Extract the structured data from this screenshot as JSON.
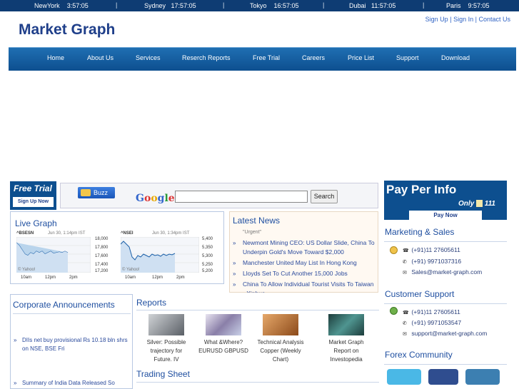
{
  "clocks": [
    {
      "city": "NewYork",
      "time": "3:57:05"
    },
    {
      "city": "Sydney",
      "time": "17:57:05"
    },
    {
      "city": "Tokyo",
      "time": "16:57:05"
    },
    {
      "city": "Dubai",
      "time": "11:57:05"
    },
    {
      "city": "Paris",
      "time": "9:57:05"
    }
  ],
  "header": {
    "logo": "Market Graph",
    "links": {
      "signup": "Sign Up",
      "signin": "Sign In",
      "contact": "Contact Us",
      "sep": "|"
    }
  },
  "nav": [
    "Home",
    "About Us",
    "Services",
    "Reserch Reports",
    "Free Trial",
    "Careers",
    "Price List",
    "Support",
    "Download"
  ],
  "free_trial": {
    "title": "Free Trial",
    "button": "Sign Up Now"
  },
  "search": {
    "buzz": "Buzz",
    "google": "Google",
    "button": "Search"
  },
  "live_graph": {
    "title": "Live Graph",
    "charts": [
      {
        "symbol": "^BSESN",
        "stamp": "Jun 30, 1:14pm IST",
        "y_ticks": [
          "18,000",
          "17,800",
          "17,600",
          "17,400",
          "17,200"
        ],
        "x_ticks": [
          "10am",
          "12pm",
          "2pm"
        ],
        "credit": "© Yahoo!"
      },
      {
        "symbol": "^NSEI",
        "stamp": "Jun 30, 1:34pm IST",
        "y_ticks": [
          "5,400",
          "5,350",
          "5,300",
          "5,250",
          "5,200"
        ],
        "x_ticks": [
          "10am",
          "12pm",
          "2pm"
        ],
        "credit": "© Yahoo!"
      }
    ]
  },
  "latest_news": {
    "title": "Latest News",
    "partial": "Urgent",
    "items": [
      "Newmont Mining CEO: US Dollar Slide, China To Underpin Gold's Move Toward $2,000",
      "Manchester United May List In Hong Kong",
      "Lloyds Set To Cut Another 15,000 Jobs",
      "China To Allow Individual Tourist Visits To Taiwan - Xinhua"
    ]
  },
  "corporate": {
    "title": "Corporate Announcements",
    "items": [
      "DIIs net buy provisional Rs 10.18 bln shrs on NSE, BSE Fri",
      "Summary of India Data Released So"
    ]
  },
  "reports": {
    "title": "Reports",
    "items": [
      {
        "label": "Silver: Possible trajectory for Future. IV",
        "color": "#8a8f96"
      },
      {
        "label": "What &Where? EURUSD GBPUSD",
        "color": "#b7b3c9"
      },
      {
        "label": "Technical Analysis Copper (Weekly Chart)",
        "color": "#b4692e"
      },
      {
        "label": "Market Graph Report on Investopedia",
        "color": "#2f6d6a"
      }
    ]
  },
  "trading_sheet": {
    "title": "Trading Sheet"
  },
  "pay_per_info": {
    "title": "Pay Per Info",
    "only": "Only",
    "price": "111",
    "button": "Pay Now"
  },
  "marketing": {
    "title": "Marketing & Sales",
    "phone1": "(+91)11 27605611",
    "phone2": "(+91) 9971037316",
    "email": "Sales@market-graph.com"
  },
  "support": {
    "title": "Customer Support",
    "phone1": "(+91)11 27605611",
    "phone2": "(+91) 9971053547",
    "email": "support@market-graph.com"
  },
  "forex": {
    "title": "Forex Community"
  },
  "colors": {
    "primary": "#0d4f8f",
    "link": "#2a4a9c",
    "title": "#1f4fa0"
  }
}
